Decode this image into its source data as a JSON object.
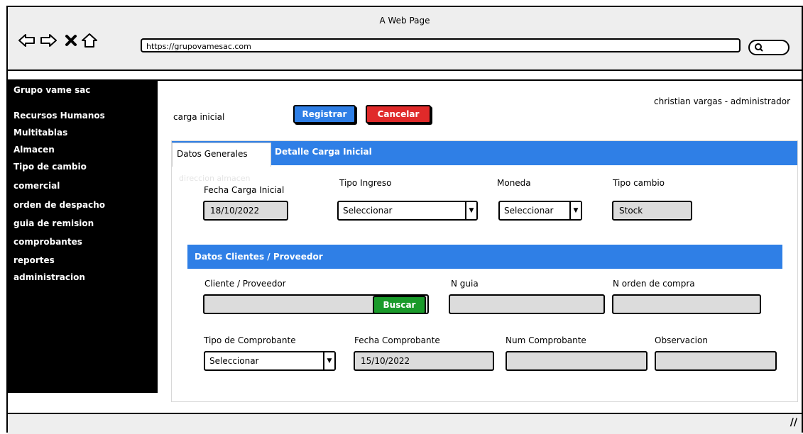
{
  "window": {
    "title": "A Web Page",
    "url": "https://grupovamesac.com"
  },
  "sidebar": {
    "brand": "Grupo vame sac",
    "items": [
      "Recursos Humanos",
      "Multitablas",
      "Almacen",
      "Tipo de cambio",
      "comercial",
      "orden de despacho",
      "guia de remision",
      "comprobantes",
      "reportes",
      "administracion"
    ]
  },
  "header": {
    "user": "christian vargas - administrador",
    "page_title": "carga inicial"
  },
  "toolbar": {
    "register": "Registrar",
    "cancel": "Cancelar"
  },
  "tabs": {
    "active": "Datos Generales",
    "other": "Detalle Carga Inicial"
  },
  "ghost_label": "direccion almacen",
  "form": {
    "fecha_carga_label": "Fecha Carga Inicial",
    "fecha_carga_value": "18/10/2022",
    "tipo_ingreso_label": "Tipo Ingreso",
    "tipo_ingreso_value": "Seleccionar",
    "moneda_label": "Moneda",
    "moneda_value": "Seleccionar",
    "tipo_cambio_label": "Tipo cambio",
    "tipo_cambio_value": "Stock"
  },
  "section2": {
    "title": "Datos Clientes / Proveedor",
    "cliente_label": "Cliente / Proveedor",
    "buscar": "Buscar",
    "nguia_label": "N guia",
    "norden_label": "N orden de compra",
    "tipo_comp_label": "Tipo de Comprobante",
    "tipo_comp_value": "Seleccionar",
    "fecha_comp_label": "Fecha Comprobante",
    "fecha_comp_value": "15/10/2022",
    "num_comp_label": "Num Comprobante",
    "obs_label": "Observacion"
  },
  "colors": {
    "accent": "#2f7fe6",
    "register": "#2f7fe6",
    "cancel": "#e02a2a",
    "buscar": "#1a9a2a"
  }
}
